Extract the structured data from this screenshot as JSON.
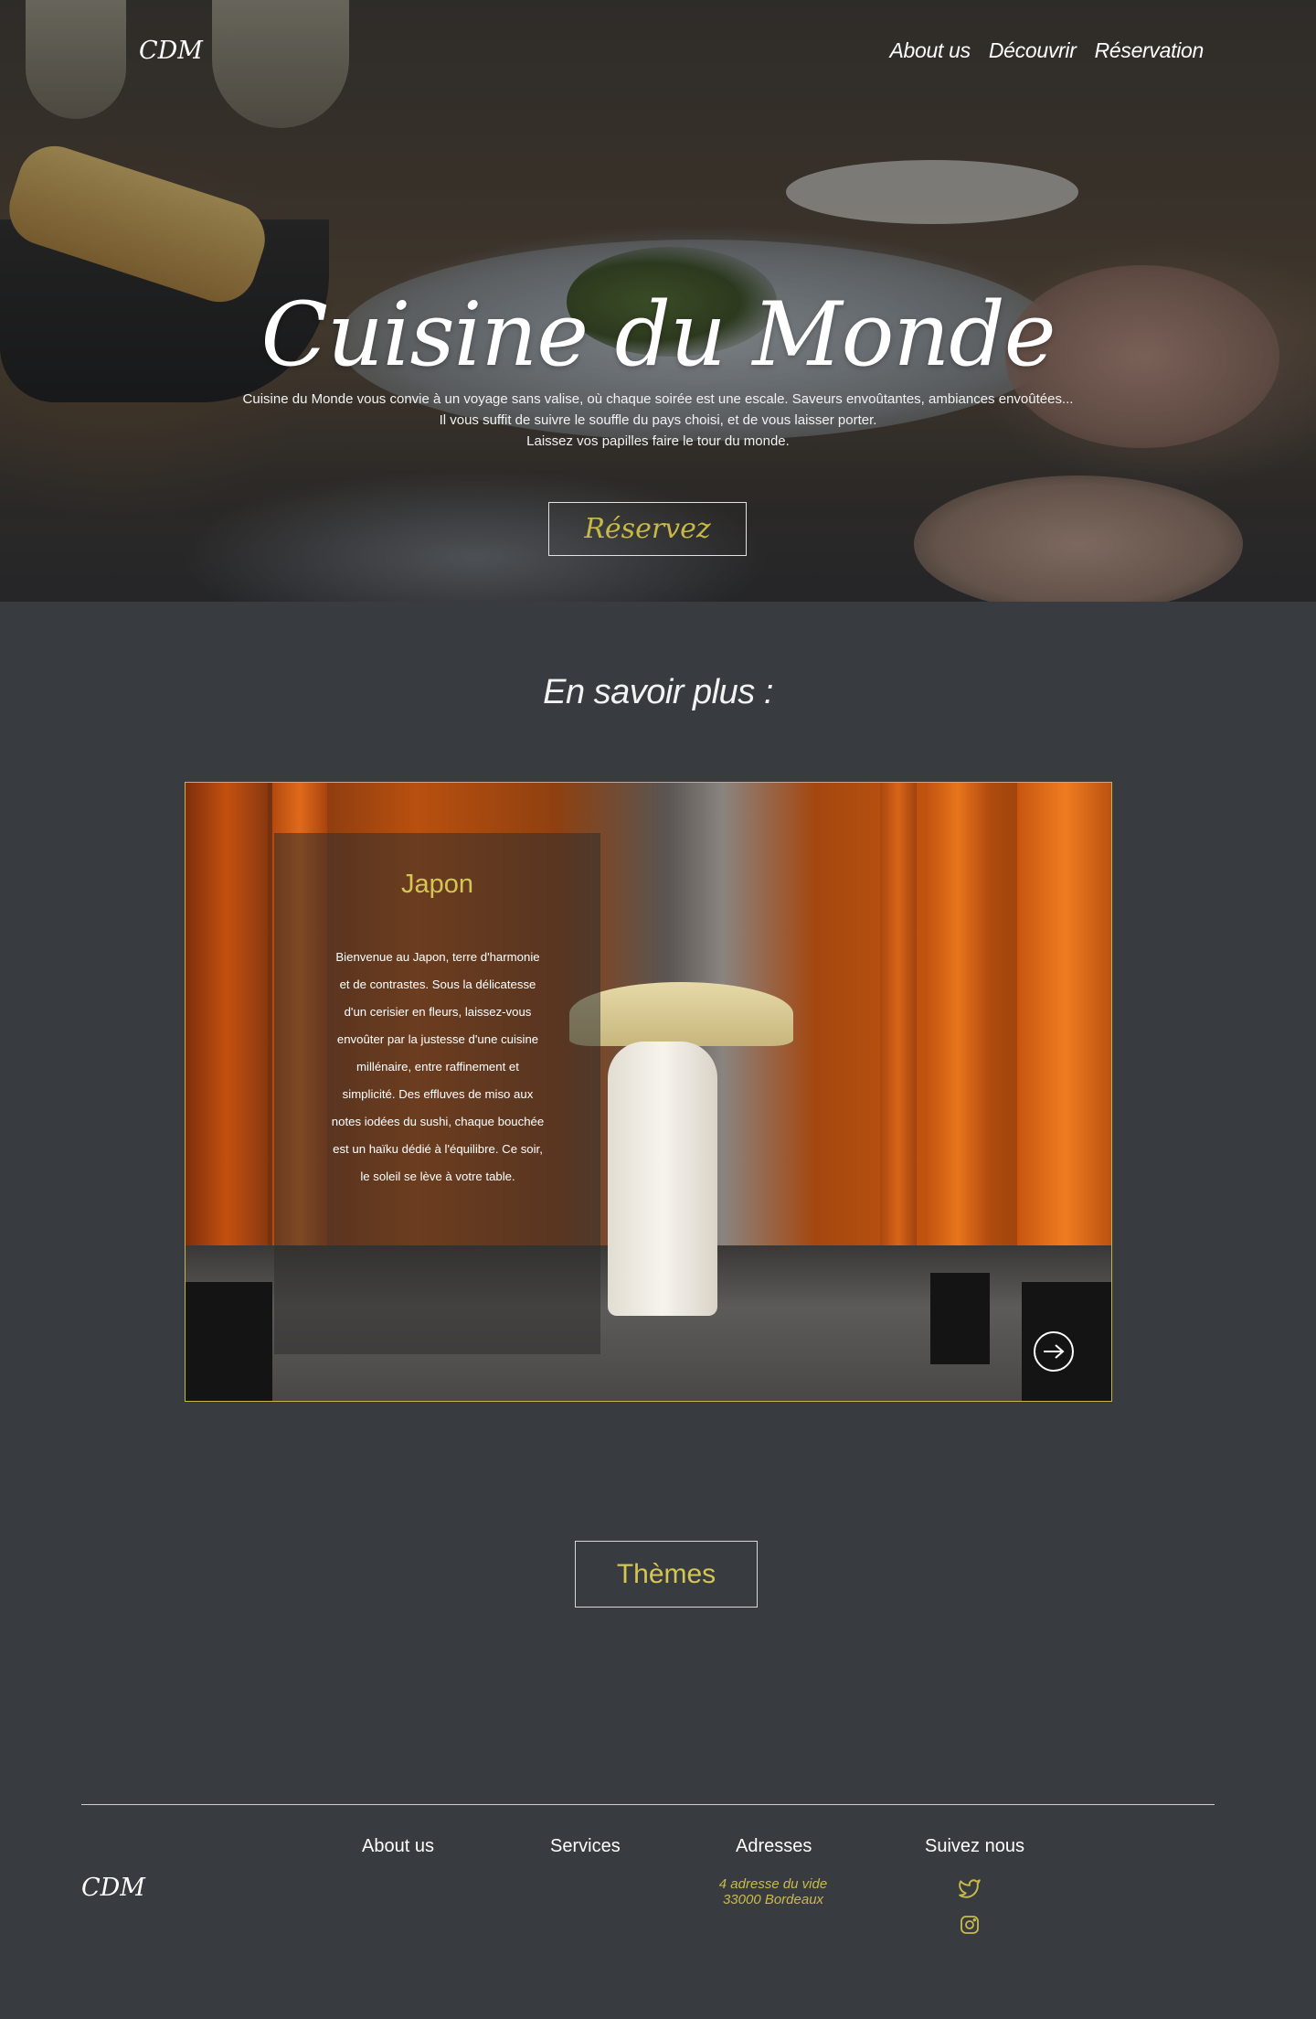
{
  "header": {
    "logo": "CDM",
    "nav": [
      "About us",
      "Découvrir",
      "Réservation"
    ]
  },
  "hero": {
    "title": "Cuisine du Monde",
    "lines": [
      "Cuisine du Monde vous convie à un voyage sans valise, où chaque soirée est une escale. Saveurs envoûtantes, ambiances envoûtées...",
      "Il vous suffit de suivre le souffle du pays choisi, et de vous laisser porter.",
      "Laissez vos papilles faire le tour du monde."
    ],
    "button": "Réservez"
  },
  "more": {
    "title": "En savoir plus :",
    "card": {
      "title": "Japon",
      "text": "Bienvenue au Japon, terre d'harmonie et de contrastes. Sous la délicatesse d'un cerisier en fleurs, laissez-vous envoûter par la justesse d'une cuisine millénaire, entre raffinement et simplicité. Des effluves de miso aux notes iodées du sushi, chaque bouchée est un haïku dédié à l'équilibre. Ce soir, le soleil se lève à votre table.",
      "next_icon": "arrow-right-circle-icon"
    },
    "themes_button": "Thèmes"
  },
  "footer": {
    "logo": "CDM",
    "columns": [
      "About us",
      "Services",
      "Adresses",
      "Suivez nous"
    ],
    "address_line1": "4 adresse du vide",
    "address_line2": "33000 Bordeaux",
    "social": [
      "twitter-icon",
      "instagram-icon"
    ]
  },
  "colors": {
    "background": "#383b3f",
    "accent": "#d4c652",
    "text": "#ffffff"
  }
}
